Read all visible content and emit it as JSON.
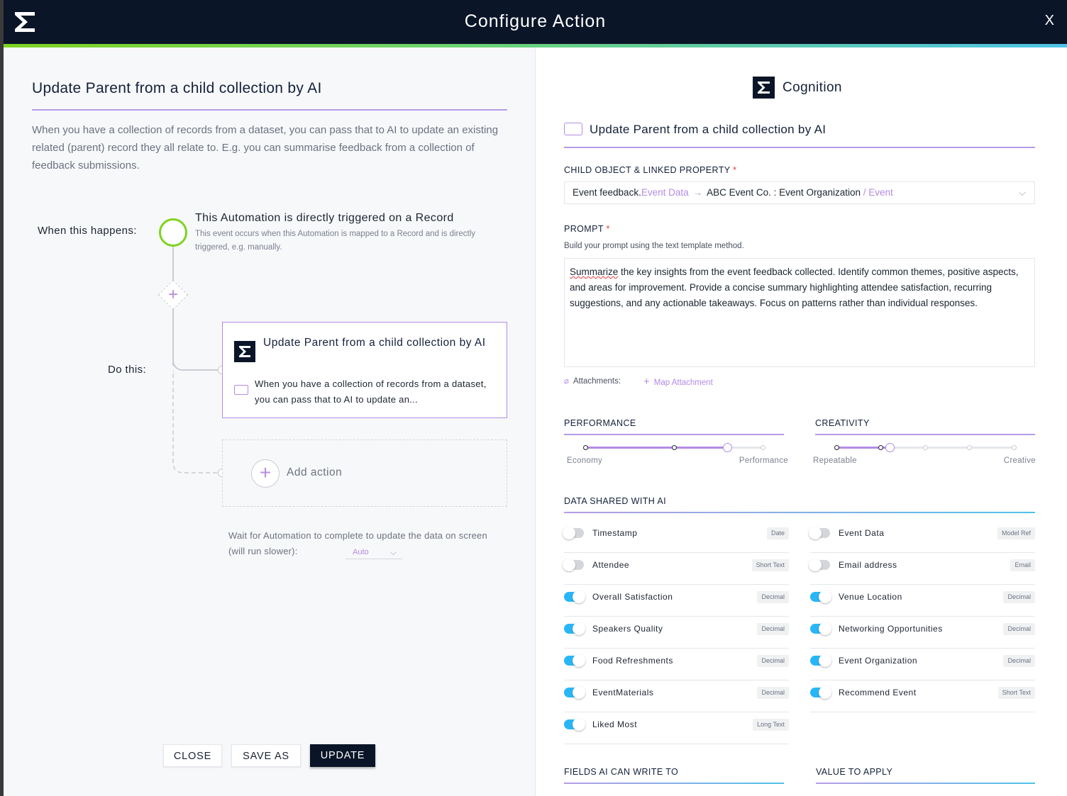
{
  "window": {
    "title": "Configure Action",
    "close_label": "X"
  },
  "left": {
    "title": "Update Parent from a child collection by AI",
    "description": "When you have a collection of records from a dataset, you can pass that to AI to update an existing related (parent) record they all relate to. E.g. you can summarise feedback from a collection of feedback submissions.",
    "when_label": "When this happens:",
    "do_label": "Do this:",
    "trigger": {
      "title": "This Automation is directly triggered on a Record",
      "desc": "This event occurs when this Automation is mapped to a Record and is directly triggered, e.g. manually."
    },
    "action_card": {
      "title": "Update Parent from a child collection by AI",
      "desc": "When you have a collection of records from a dataset, you can pass that to AI to update an..."
    },
    "add_action_label": "Add action",
    "wait_text": "Wait for Automation to complete to update the data on screen (will run slower):",
    "wait_value": "Auto",
    "buttons": {
      "close": "CLOSE",
      "save_as": "SAVE AS",
      "update": "UPDATE"
    }
  },
  "right": {
    "brand": "Cognition",
    "heading": "Update Parent from a child collection by AI",
    "child_object": {
      "label": "CHILD OBJECT & LINKED PROPERTY",
      "required_mark": "*",
      "part1": "Event feedback.",
      "part2": "Event Data",
      "arrow": "→",
      "part3": "ABC Event Co. : Event Organization",
      "part4": " / Event"
    },
    "prompt": {
      "label": "PROMPT",
      "required_mark": "*",
      "hint": "Build your prompt using the text template method.",
      "first_word": "Summarize",
      "rest": " the key insights from the event feedback collected. Identify common themes, positive aspects, and areas for improvement. Provide a concise summary highlighting attendee satisfaction, recurring suggestions, and any actionable takeaways. Focus on patterns rather than individual responses."
    },
    "attachments_label": "Attachments:",
    "map_attachment_label": "Map Attachment",
    "performance": {
      "label": "PERFORMANCE",
      "min": "Economy",
      "max": "Performance",
      "level": 3,
      "steps": 5
    },
    "creativity": {
      "label": "CREATIVITY",
      "min": "Repeatable",
      "max": "Creative",
      "level": 2,
      "steps": 5
    },
    "data_shared_label": "DATA SHARED WITH AI",
    "fields_left": [
      {
        "label": "Timestamp",
        "type": "Date",
        "on": false
      },
      {
        "label": "Attendee",
        "type": "Short Text",
        "on": false
      },
      {
        "label": "Overall Satisfaction",
        "type": "Decimal",
        "on": true
      },
      {
        "label": "Speakers Quality",
        "type": "Decimal",
        "on": true
      },
      {
        "label": "Food Refreshments",
        "type": "Decimal",
        "on": true
      },
      {
        "label": "EventMaterials",
        "type": "Decimal",
        "on": true
      },
      {
        "label": "Liked Most",
        "type": "Long Text",
        "on": true
      }
    ],
    "fields_right": [
      {
        "label": "Event Data",
        "type": "Model Ref",
        "on": false
      },
      {
        "label": "Email address",
        "type": "Email",
        "on": false
      },
      {
        "label": "Venue Location",
        "type": "Decimal",
        "on": true
      },
      {
        "label": "Networking Opportunities",
        "type": "Decimal",
        "on": true
      },
      {
        "label": "Event Organization",
        "type": "Decimal",
        "on": true
      },
      {
        "label": "Recommend Event",
        "type": "Short Text",
        "on": true
      }
    ],
    "fields_ai_write_label": "FIELDS AI CAN WRITE TO",
    "value_to_apply_label": "VALUE TO APPLY"
  },
  "colors": {
    "accent": "#b48be5",
    "toggle_on": "#29b6f6",
    "trigger": "#7ed321",
    "dark": "#0a1528"
  }
}
